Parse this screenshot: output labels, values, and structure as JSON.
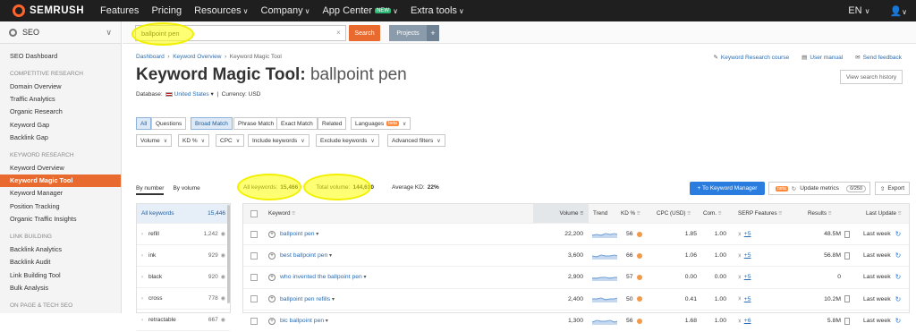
{
  "topnav": {
    "brand": "SEMRUSH",
    "items": [
      {
        "label": "Features",
        "dropdown": false
      },
      {
        "label": "Pricing",
        "dropdown": false
      },
      {
        "label": "Resources",
        "dropdown": true
      },
      {
        "label": "Company",
        "dropdown": true
      },
      {
        "label": "App Center",
        "dropdown": true,
        "badge": "NEW"
      },
      {
        "label": "Extra tools",
        "dropdown": true
      }
    ],
    "language": "EN",
    "user_icon": "user-icon"
  },
  "sidebar": {
    "header": "SEO",
    "sections": [
      {
        "title": "",
        "items": [
          "SEO Dashboard"
        ]
      },
      {
        "title": "COMPETITIVE RESEARCH",
        "items": [
          "Domain Overview",
          "Traffic Analytics",
          "Organic Research",
          "Keyword Gap",
          "Backlink Gap"
        ]
      },
      {
        "title": "KEYWORD RESEARCH",
        "items": [
          "Keyword Overview",
          "Keyword Magic Tool",
          "Keyword Manager",
          "Position Tracking",
          "Organic Traffic Insights"
        ]
      },
      {
        "title": "LINK BUILDING",
        "items": [
          "Backlink Analytics",
          "Backlink Audit",
          "Link Building Tool",
          "Bulk Analysis"
        ]
      },
      {
        "title": "ON PAGE & TECH SEO",
        "items": []
      }
    ],
    "active": "Keyword Magic Tool"
  },
  "search": {
    "value": "ballpoint pen",
    "button": "Search",
    "projects": "Projects",
    "plus": "+"
  },
  "breadcrumb": [
    "Dashboard",
    "Keyword Overview",
    "Keyword Magic Tool"
  ],
  "toplinks": [
    "Keyword Research course",
    "User manual",
    "Send feedback"
  ],
  "title": {
    "prefix": "Keyword Magic Tool:",
    "keyword": "ballpoint pen"
  },
  "database": {
    "label": "Database:",
    "value": "United States",
    "currency": "Currency: USD"
  },
  "view_history": "View search history",
  "filters": {
    "row1": {
      "all": "All",
      "questions": "Questions",
      "broad": "Broad Match",
      "phrase": "Phrase Match",
      "exact": "Exact Match",
      "related": "Related",
      "languages": "Languages",
      "beta": "beta"
    },
    "row2": [
      "Volume",
      "KD %",
      "CPC",
      "Include keywords",
      "Exclude keywords",
      "Advanced filters"
    ]
  },
  "stats": {
    "by_number": "By number",
    "by_volume": "By volume",
    "all_keywords_label": "All keywords:",
    "all_keywords": "15,466",
    "total_volume_label": "Total volume:",
    "total_volume": "144,610",
    "avg_kd_label": "Average KD:",
    "avg_kd": "22%",
    "to_km": "+ To Keyword Manager",
    "update_metrics": "Update metrics",
    "update_count": "0/250",
    "export": "Export",
    "beta": "beta"
  },
  "groups": [
    {
      "label": "All keywords",
      "count": "15,446"
    },
    {
      "label": "refill",
      "count": "1,242"
    },
    {
      "label": "ink",
      "count": "929"
    },
    {
      "label": "black",
      "count": "920"
    },
    {
      "label": "cross",
      "count": "778"
    },
    {
      "label": "retractable",
      "count": "667"
    }
  ],
  "table": {
    "headers": [
      "Keyword",
      "Volume",
      "Trend",
      "KD %",
      "CPC (USD)",
      "Com.",
      "SERP Features",
      "Results",
      "Last Update"
    ],
    "rows": [
      {
        "keyword": "ballpoint pen",
        "volume": "22,200",
        "kd": "56",
        "cpc": "1.85",
        "com": "1.00",
        "serp": "+5",
        "results": "48.5M",
        "update": "Last week"
      },
      {
        "keyword": "best ballpoint pen",
        "volume": "3,600",
        "kd": "66",
        "cpc": "1.06",
        "com": "1.00",
        "serp": "+5",
        "results": "56.8M",
        "update": "Last week"
      },
      {
        "keyword": "who invented the ballpoint pen",
        "volume": "2,900",
        "kd": "57",
        "cpc": "0.00",
        "com": "0.00",
        "serp": "+5",
        "results": "0",
        "update": "Last week"
      },
      {
        "keyword": "ballpoint pen refills",
        "volume": "2,400",
        "kd": "50",
        "cpc": "0.41",
        "com": "1.00",
        "serp": "+5",
        "results": "10.2M",
        "update": "Last week"
      },
      {
        "keyword": "bic ballpoint pen",
        "volume": "1,300",
        "kd": "56",
        "cpc": "1.68",
        "com": "1.00",
        "serp": "+6",
        "results": "5.8M",
        "update": "Last week"
      }
    ]
  },
  "colors": {
    "accent": "#e86a2f",
    "link": "#2b6cb0",
    "kd_hard": "#f2994a",
    "highlight": "#ffff00"
  }
}
